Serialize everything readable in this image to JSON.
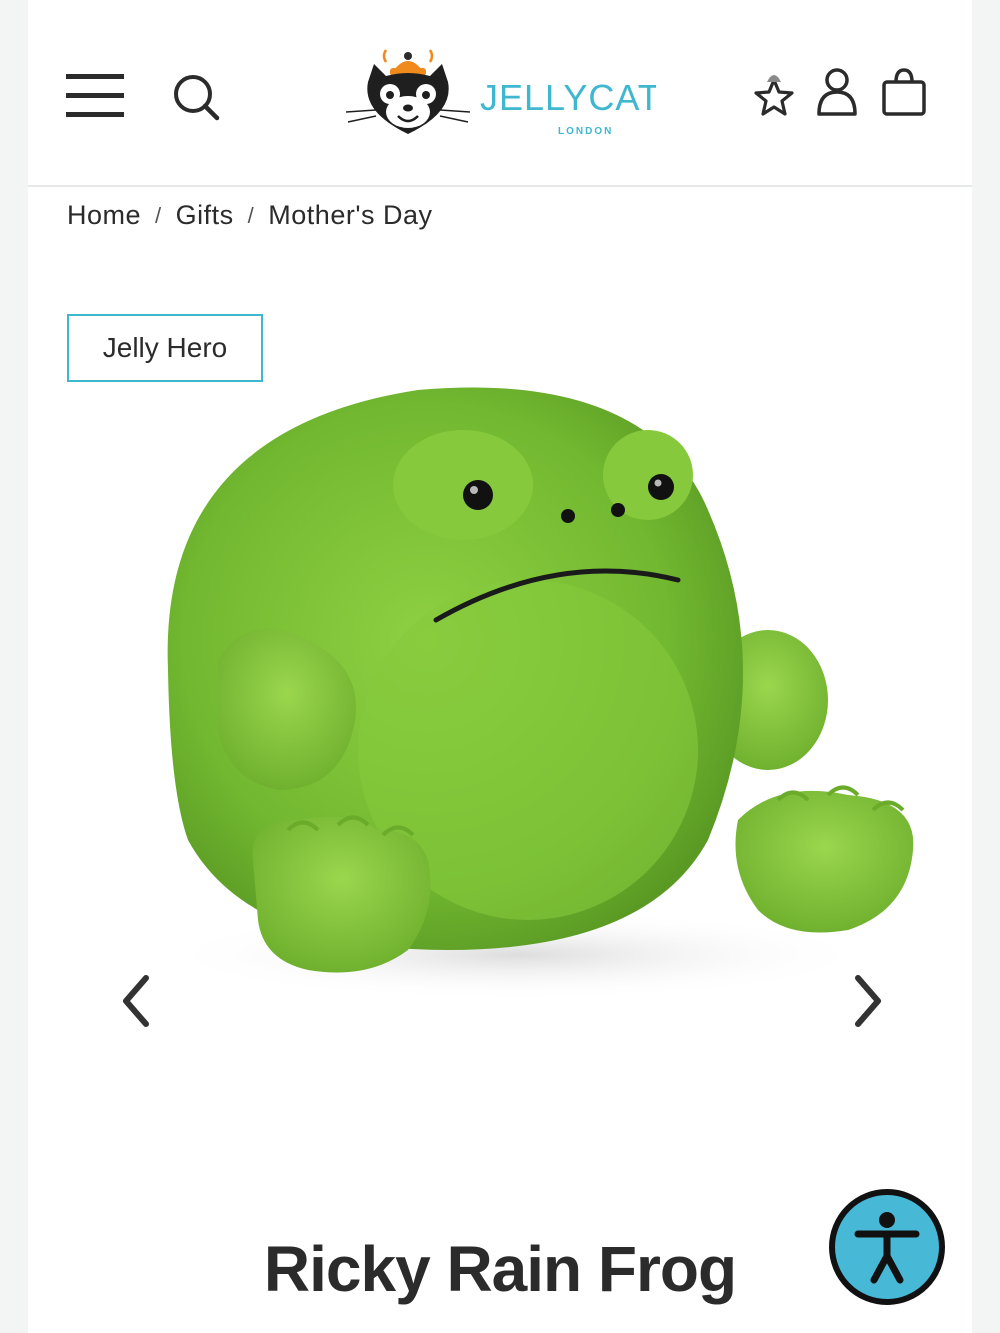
{
  "header": {
    "logo_text": "JELLYCAT",
    "logo_subtext": "LONDON"
  },
  "breadcrumb": [
    {
      "label": "Home"
    },
    {
      "label": "Gifts"
    },
    {
      "label": "Mother's Day"
    }
  ],
  "breadcrumb_separator": "/",
  "product": {
    "badge": "Jelly Hero",
    "title": "Ricky Rain Frog"
  },
  "colors": {
    "brand_teal": "#3fb7cf",
    "accessibility_button": "#47b8d6",
    "text": "#2b2b2b",
    "frog_green": "#7cc23a"
  },
  "icons": {
    "menu": "hamburger-icon",
    "search": "search-icon",
    "wishlist": "star-bell-icon",
    "account": "user-icon",
    "bag": "shopping-bag-icon",
    "prev": "chevron-left-icon",
    "next": "chevron-right-icon",
    "accessibility": "accessibility-icon"
  }
}
